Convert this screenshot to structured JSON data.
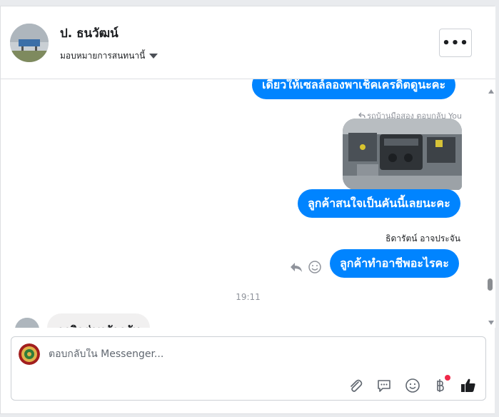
{
  "header": {
    "contact_name": "ป. ธนวัฒน์",
    "assign_label": "มอบหมายการสนทนานี้",
    "more_label": "•••"
  },
  "messages": [
    {
      "type": "out",
      "text": "เดี๋ยวให้เซลล์ลองพาเช็คเครดิตดูนะคะ"
    },
    {
      "type": "reply_note",
      "text": "รถบ้านมือสอง ตอบกลับ You"
    },
    {
      "type": "out",
      "text": "ลูกค้าสนใจเป็นคันนี้เลยนะคะ"
    },
    {
      "type": "sender",
      "text": "ธิดารัตน์ อาจประจัน"
    },
    {
      "type": "out",
      "text": "ลูกค้าทำอาชีพอะไรคะ"
    },
    {
      "type": "timestamp",
      "text": "19:11"
    },
    {
      "type": "in",
      "text": "ธุรกิจส่วนตัวครับ"
    }
  ],
  "composer": {
    "placeholder": "ตอบกลับใน Messenger..."
  },
  "icons": {
    "tools": [
      "paperclip-icon",
      "saved-reply-icon",
      "emoji-icon",
      "baht-payment-icon",
      "like-icon"
    ],
    "message_actions": [
      "reply-icon",
      "react-emoji-icon"
    ]
  },
  "colors": {
    "outgoing_bubble": "#0084ff",
    "incoming_bubble": "#f1f0f0",
    "notification_dot": "#f02849"
  }
}
